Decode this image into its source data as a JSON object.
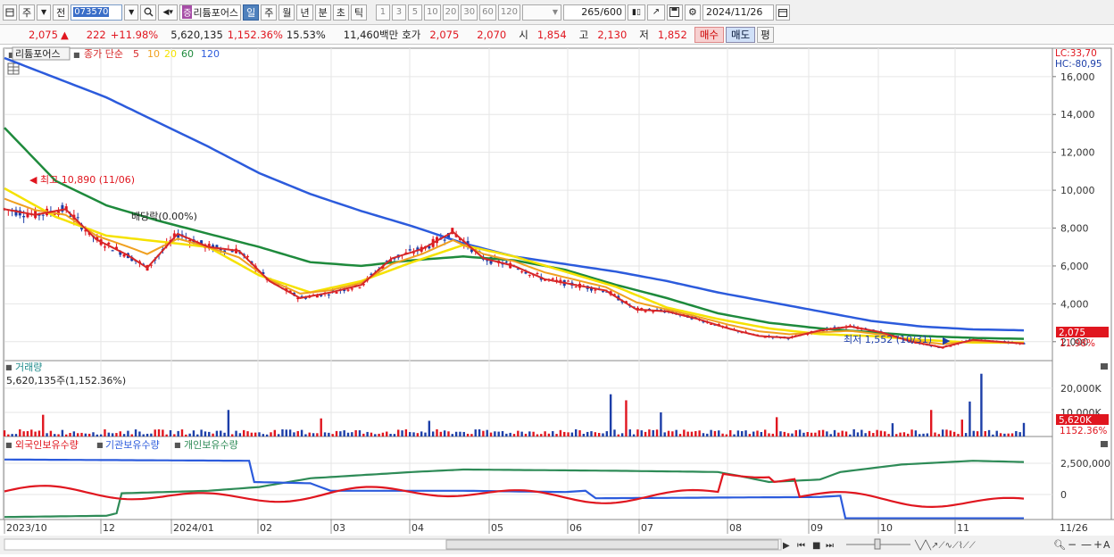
{
  "toolbar": {
    "type_select": "주",
    "prev_label": "전",
    "stock_code": "073570",
    "name_tag": "증",
    "stock_name": "리튬포어스",
    "periods": [
      "일",
      "주",
      "월",
      "년",
      "분",
      "초",
      "틱"
    ],
    "active_period": "일",
    "intervals": [
      "1",
      "3",
      "5",
      "10",
      "20",
      "30",
      "60",
      "120"
    ],
    "count": "265/600",
    "date": "2024/11/26"
  },
  "quote": {
    "price": "2,075",
    "change": "222",
    "change_pct": "+11.98%",
    "volume": "5,620,135",
    "volume_pct": "1,152.36%",
    "turnover": "15.53%",
    "amount": "11,460백만",
    "bid_label": "호가",
    "ask": "2,075",
    "bid": "2,070",
    "open_label": "시",
    "open": "1,854",
    "high_label": "고",
    "high": "2,130",
    "low_label": "저",
    "low": "1,852",
    "buy_label": "매수",
    "sell_label": "매도",
    "avg_label": "평"
  },
  "price_panel": {
    "stock_label": "리튬포어스",
    "ma_label": "종가 단순",
    "ma_periods": [
      "5",
      "10",
      "20",
      "60",
      "120"
    ],
    "ma_colors": [
      "#d62728",
      "#f0a020",
      "#f5e200",
      "#1e8a3c",
      "#2c5bdc"
    ],
    "lc": "LC:33,70",
    "hc": "HC:-80,95",
    "y_ticks": [
      "16,000",
      "14,000",
      "12,000",
      "10,000",
      "8,000",
      "6,000",
      "4,000",
      "2,000"
    ],
    "current_price": "2,075",
    "current_pct": "11.98%",
    "high_note": "최고 10,890 (11/06)",
    "low_note": "최저 1,552 (10/31)",
    "div_note": "배당락(0.00%)"
  },
  "volume_panel": {
    "title": "거래량",
    "value": "5,620,135주(1,152.36%)",
    "y_ticks": [
      "20,000K",
      "10,000K"
    ],
    "current": "5,620K",
    "current_pct": "1152.36%"
  },
  "holdings_panel": {
    "labels": [
      "외국인보유수량",
      "기관보유수량",
      "개인보유수량"
    ],
    "colors": [
      "#e0161f",
      "#2c5bdc",
      "#2e8b57"
    ],
    "y_ticks": [
      "2,500,000",
      "0"
    ]
  },
  "x_axis": {
    "labels": [
      "2023/10",
      "12",
      "2024/01",
      "02",
      "03",
      "04",
      "05",
      "06",
      "07",
      "08",
      "09",
      "10",
      "11"
    ],
    "end_label": "11/26"
  },
  "chart_data": {
    "type": "candlestick",
    "price_range": [
      1000,
      17500
    ],
    "ma120": [
      [
        0,
        16980
      ],
      [
        0.1,
        14900
      ],
      [
        0.2,
        12300
      ],
      [
        0.25,
        10900
      ],
      [
        0.3,
        9800
      ],
      [
        0.35,
        8900
      ],
      [
        0.4,
        8100
      ],
      [
        0.45,
        7200
      ],
      [
        0.5,
        6500
      ],
      [
        0.55,
        6100
      ],
      [
        0.6,
        5700
      ],
      [
        0.65,
        5200
      ],
      [
        0.7,
        4600
      ],
      [
        0.75,
        4100
      ],
      [
        0.8,
        3600
      ],
      [
        0.85,
        3100
      ],
      [
        0.9,
        2800
      ],
      [
        0.95,
        2650
      ],
      [
        1.0,
        2600
      ]
    ],
    "ma60": [
      [
        0,
        13300
      ],
      [
        0.05,
        10500
      ],
      [
        0.1,
        9200
      ],
      [
        0.15,
        8400
      ],
      [
        0.2,
        7700
      ],
      [
        0.25,
        7000
      ],
      [
        0.3,
        6200
      ],
      [
        0.35,
        6000
      ],
      [
        0.4,
        6300
      ],
      [
        0.45,
        6500
      ],
      [
        0.5,
        6300
      ],
      [
        0.55,
        5800
      ],
      [
        0.6,
        5000
      ],
      [
        0.65,
        4300
      ],
      [
        0.7,
        3500
      ],
      [
        0.75,
        3000
      ],
      [
        0.8,
        2700
      ],
      [
        0.85,
        2500
      ],
      [
        0.9,
        2300
      ],
      [
        0.95,
        2200
      ],
      [
        1.0,
        2150
      ]
    ],
    "ma20": [
      [
        0,
        10100
      ],
      [
        0.05,
        8600
      ],
      [
        0.1,
        7600
      ],
      [
        0.15,
        7300
      ],
      [
        0.2,
        7000
      ],
      [
        0.25,
        5500
      ],
      [
        0.3,
        4600
      ],
      [
        0.35,
        5200
      ],
      [
        0.4,
        6200
      ],
      [
        0.45,
        7100
      ],
      [
        0.5,
        6500
      ],
      [
        0.55,
        5700
      ],
      [
        0.6,
        4900
      ],
      [
        0.65,
        3800
      ],
      [
        0.7,
        3200
      ],
      [
        0.75,
        2700
      ],
      [
        0.8,
        2400
      ],
      [
        0.85,
        2300
      ],
      [
        0.9,
        2100
      ],
      [
        0.95,
        1950
      ],
      [
        1.0,
        1950
      ]
    ],
    "ma5": [
      [
        0,
        9000
      ],
      [
        0.03,
        8700
      ],
      [
        0.06,
        9000
      ],
      [
        0.09,
        7400
      ],
      [
        0.12,
        6600
      ],
      [
        0.14,
        5900
      ],
      [
        0.17,
        7700
      ],
      [
        0.2,
        7000
      ],
      [
        0.23,
        6800
      ],
      [
        0.26,
        5200
      ],
      [
        0.29,
        4300
      ],
      [
        0.32,
        4600
      ],
      [
        0.35,
        5000
      ],
      [
        0.38,
        6400
      ],
      [
        0.41,
        6900
      ],
      [
        0.44,
        7800
      ],
      [
        0.47,
        6400
      ],
      [
        0.5,
        6000
      ],
      [
        0.53,
        5300
      ],
      [
        0.56,
        5000
      ],
      [
        0.59,
        4700
      ],
      [
        0.62,
        3700
      ],
      [
        0.65,
        3600
      ],
      [
        0.68,
        3200
      ],
      [
        0.71,
        2700
      ],
      [
        0.74,
        2300
      ],
      [
        0.77,
        2200
      ],
      [
        0.8,
        2600
      ],
      [
        0.83,
        2800
      ],
      [
        0.86,
        2500
      ],
      [
        0.89,
        2000
      ],
      [
        0.92,
        1700
      ],
      [
        0.95,
        2100
      ],
      [
        1.0,
        1900
      ]
    ],
    "volume_range": [
      0,
      27000
    ],
    "holdings_range": [
      -2000000,
      3500000
    ]
  }
}
